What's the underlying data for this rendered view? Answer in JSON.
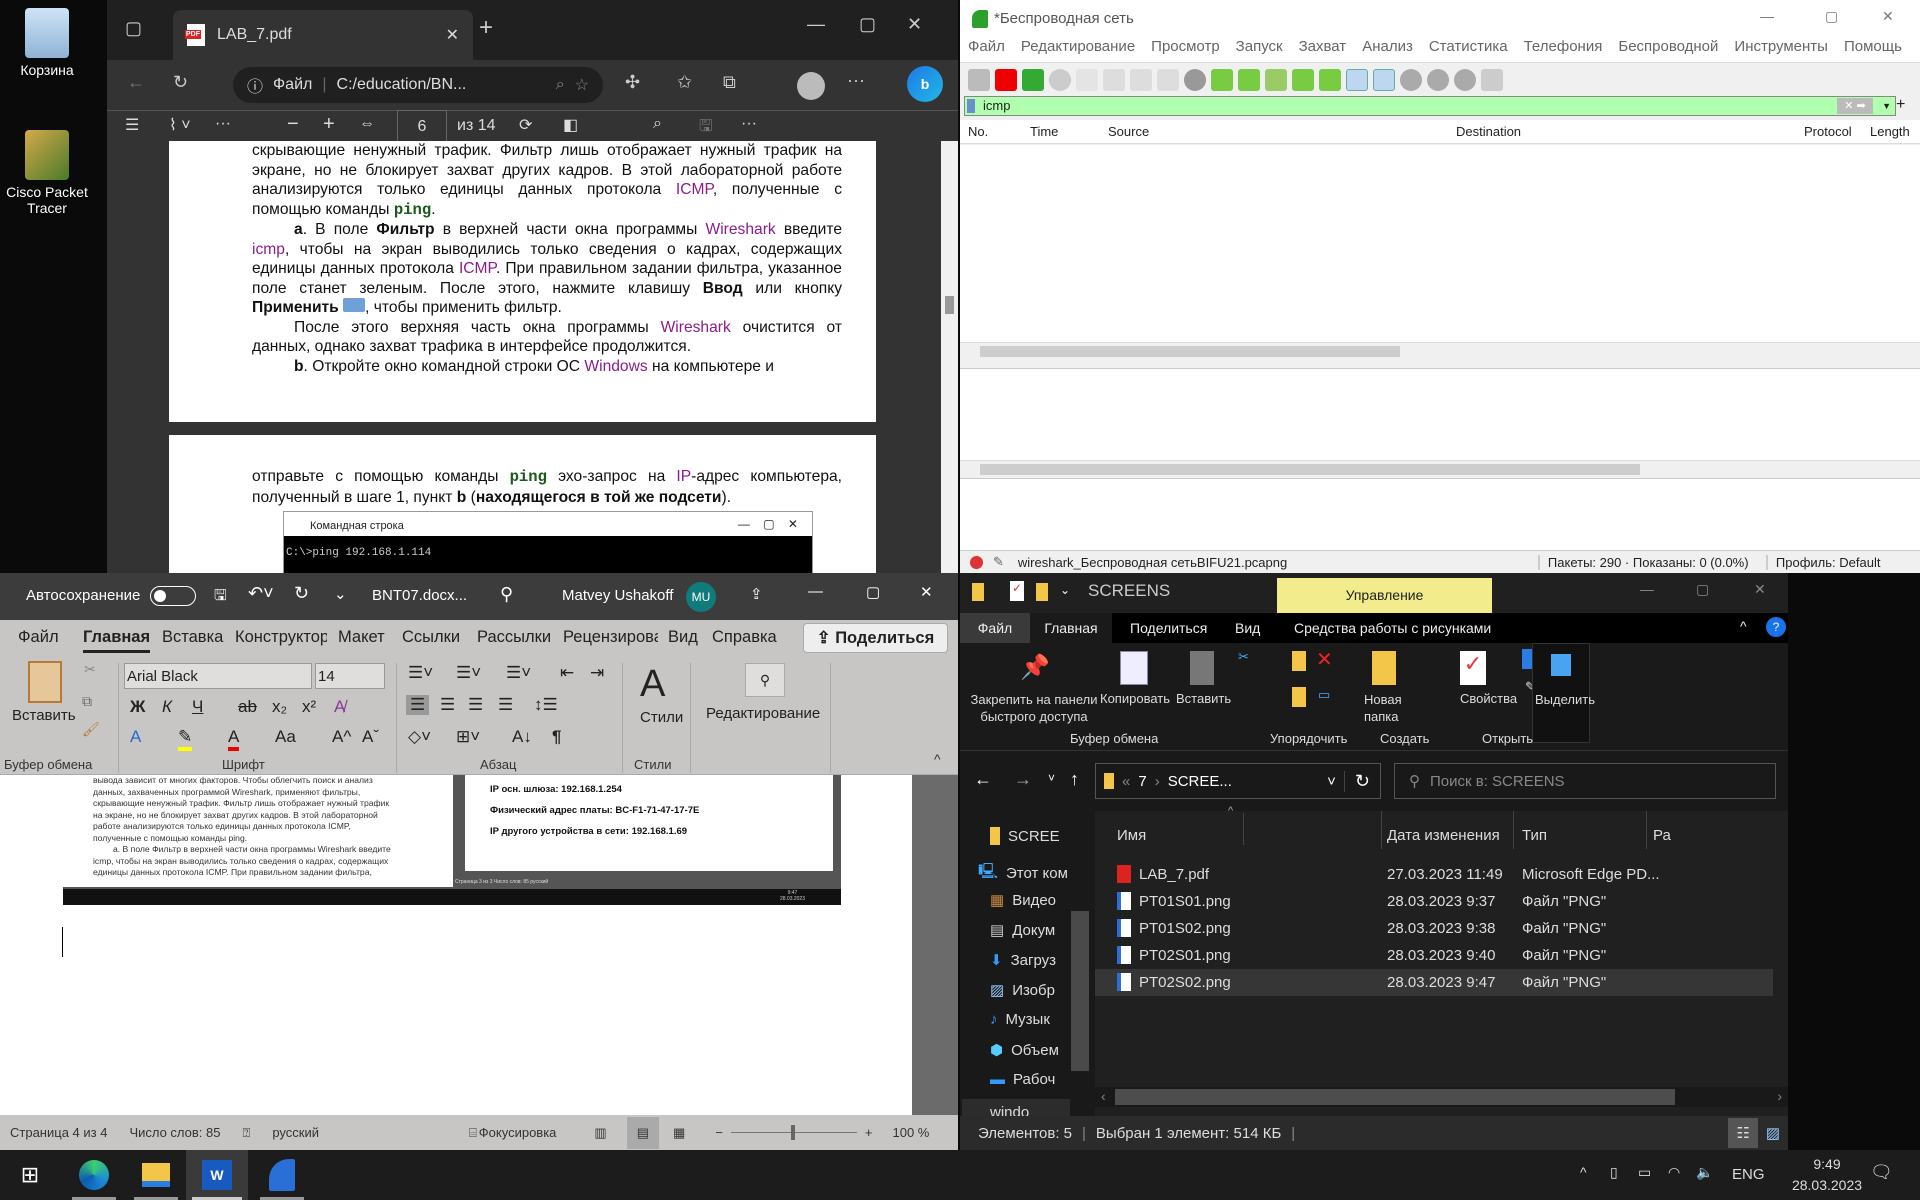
{
  "desktop": {
    "icons": [
      {
        "label": "Корзина"
      },
      {
        "label": "Cisco Packet Tracer"
      }
    ]
  },
  "edge": {
    "tab_title": "LAB_7.pdf",
    "address_label": "Файл",
    "url": "C:/education/BN...",
    "page_current": "6",
    "page_total": "из 14",
    "page1": [
      "скрывающие ненужный трафик. Фильтр лишь отображает нужный трафик на экране, но не блокирует захват других кадров. В этой лабораторной работе анализируются только единицы данных протокола ",
      "ICMP",
      ", полученные с помощью команды ",
      "ping",
      "."
    ],
    "para_a": {
      "lead": "a",
      "t1": ". В поле ",
      "b1": "Фильтр",
      "t2": " в верхней части окна программы ",
      "p1": "Wireshark",
      "t3": " введите ",
      "p2": "icmp",
      "t4": ", чтобы на экран выводились только сведения о кадрах, содержащих единицы данных протокола ",
      "p3": "ICMP",
      "t5": ". При правильном задании фильтра, указанное поле станет зеленым. После этого, нажмите клавишу ",
      "b2": "Ввод",
      "t6": " или кнопку ",
      "b3": "Применить",
      "t7": ", чтобы применить фильтр."
    },
    "para_after": {
      "t1": "После этого верхняя часть окна программы ",
      "p1": "Wireshark",
      "t2": " очистится от данных, однако захват трафика в интерфейсе продолжится."
    },
    "para_b": {
      "lead": "b",
      "t1": ". Откройте окно командной строки ОС ",
      "p1": "Windows",
      "t2": " на компьютере и"
    },
    "page2": {
      "t1": "отправьте с помощью команды ",
      "m1": "ping",
      "t2": " эхо-запрос на ",
      "p1": "IP",
      "t3": "-адрес компьютера, полученный в шаге 1, пункт ",
      "b1": "b",
      "t4": " (",
      "b2": "находящегося в той же подсети",
      "t5": ")."
    },
    "cmd": {
      "title": "Командная строка",
      "line": "C:\\>ping 192.168.1.114"
    }
  },
  "wireshark": {
    "title": "*Беспроводная сеть",
    "menu": [
      "Файл",
      "Редактирование",
      "Просмотр",
      "Запуск",
      "Захват",
      "Анализ",
      "Статистика",
      "Телефония",
      "Беспроводной",
      "Инструменты",
      "Помощь"
    ],
    "filter": "icmp",
    "columns": [
      "No.",
      "Time",
      "Source",
      "Destination",
      "Protocol",
      "Length"
    ],
    "status_file": "wireshark_Беспроводная сетьBIFU21.pcapng",
    "status_packets": "Пакеты: 290 · Показаны: 0 (0.0%)",
    "status_profile": "Профиль: Default"
  },
  "word": {
    "autosave": "Автосохранение",
    "filename": "BNT07.docx...",
    "user": "Matvey Ushakoff",
    "initials": "MU",
    "tabs": [
      "Файл",
      "Главная",
      "Вставка",
      "Конструктор",
      "Макет",
      "Ссылки",
      "Рассылки",
      "Рецензирова",
      "Вид",
      "Справка"
    ],
    "share": "Поделиться",
    "font": "Arial Black",
    "size": "14",
    "paste": "Вставить",
    "styles": "Стили",
    "editing": "Редактирование",
    "groups": [
      "Буфер обмена",
      "Шрифт",
      "Абзац",
      "Стили"
    ],
    "fmt": [
      "Ж",
      "К",
      "Ч",
      "ab",
      "x₂",
      "x²"
    ],
    "embedded_left": [
      "вывода зависит от многих факторов. Чтобы облегчить поиск и анализ",
      "данных, захваченных программой Wireshark, применяют фильтры,",
      "скрывающие ненужный трафик. Фильтр лишь отображает нужный трафик",
      "на экране, но не блокирует захват других кадров. В этой лабораторной",
      "работе анализируются только единицы данных протокола ICMP,",
      "полученные с помощью команды ping.",
      "a. В поле Фильтр в верхней части окна программы Wireshark введите",
      "icmp, чтобы на экран выводились только сведения о кадрах, содержащих",
      "единицы данных протокола ICMP. При правильном задании фильтра,"
    ],
    "embedded_right": [
      "IP осн. шлюза: 192.168.1.254",
      "Физический адрес платы: BC-F1-71-47-17-7E",
      "IP другого устройства в сети: 192.168.1.69"
    ],
    "embedded_status": "Страница 3 из 3   Число слов: 85   русский",
    "embedded_clock": [
      "9:47",
      "28.03.2023"
    ],
    "status": {
      "page": "Страница 4 из 4",
      "words": "Число слов: 85",
      "lang": "русский",
      "focus": "Фокусировка",
      "zoom": "100 %"
    },
    "zoom_percent": 100
  },
  "explorer": {
    "title": "SCREENS",
    "manage": "Управление",
    "tabs": [
      "Файл",
      "Главная",
      "Поделиться",
      "Вид",
      "Средства работы с рисунками"
    ],
    "ribbon": {
      "pin": "Закрепить на панели быстрого доступа",
      "copy": "Копировать",
      "paste": "Вставить",
      "new_folder": "Новая папка",
      "properties": "Свойства",
      "select": "Выделить",
      "groups": [
        "Буфер обмена",
        "Упорядочить",
        "Создать",
        "Открыть"
      ]
    },
    "path": [
      "7",
      "SCREE..."
    ],
    "search_placeholder": "Поиск в: SCREENS",
    "nav": [
      "SCREE",
      "Этот ком",
      "Видео",
      "Докум",
      "Загруз",
      "Изобр",
      "Музык",
      "Объем",
      "Рабоч",
      "windo"
    ],
    "columns": [
      "Имя",
      "Дата изменения",
      "Тип",
      "Ра"
    ],
    "files": [
      {
        "name": "LAB_7.pdf",
        "date": "27.03.2023 11:49",
        "type": "Microsoft Edge PD..."
      },
      {
        "name": "PT01S01.png",
        "date": "28.03.2023 9:37",
        "type": "Файл \"PNG\""
      },
      {
        "name": "PT01S02.png",
        "date": "28.03.2023 9:38",
        "type": "Файл \"PNG\""
      },
      {
        "name": "PT02S01.png",
        "date": "28.03.2023 9:40",
        "type": "Файл \"PNG\""
      },
      {
        "name": "PT02S02.png",
        "date": "28.03.2023 9:47",
        "type": "Файл \"PNG\""
      }
    ],
    "status_count": "Элементов: 5",
    "status_selected": "Выбран 1 элемент: 514 КБ"
  },
  "taskbar": {
    "lang": "ENG",
    "time": "9:49",
    "date": "28.03.2023"
  }
}
